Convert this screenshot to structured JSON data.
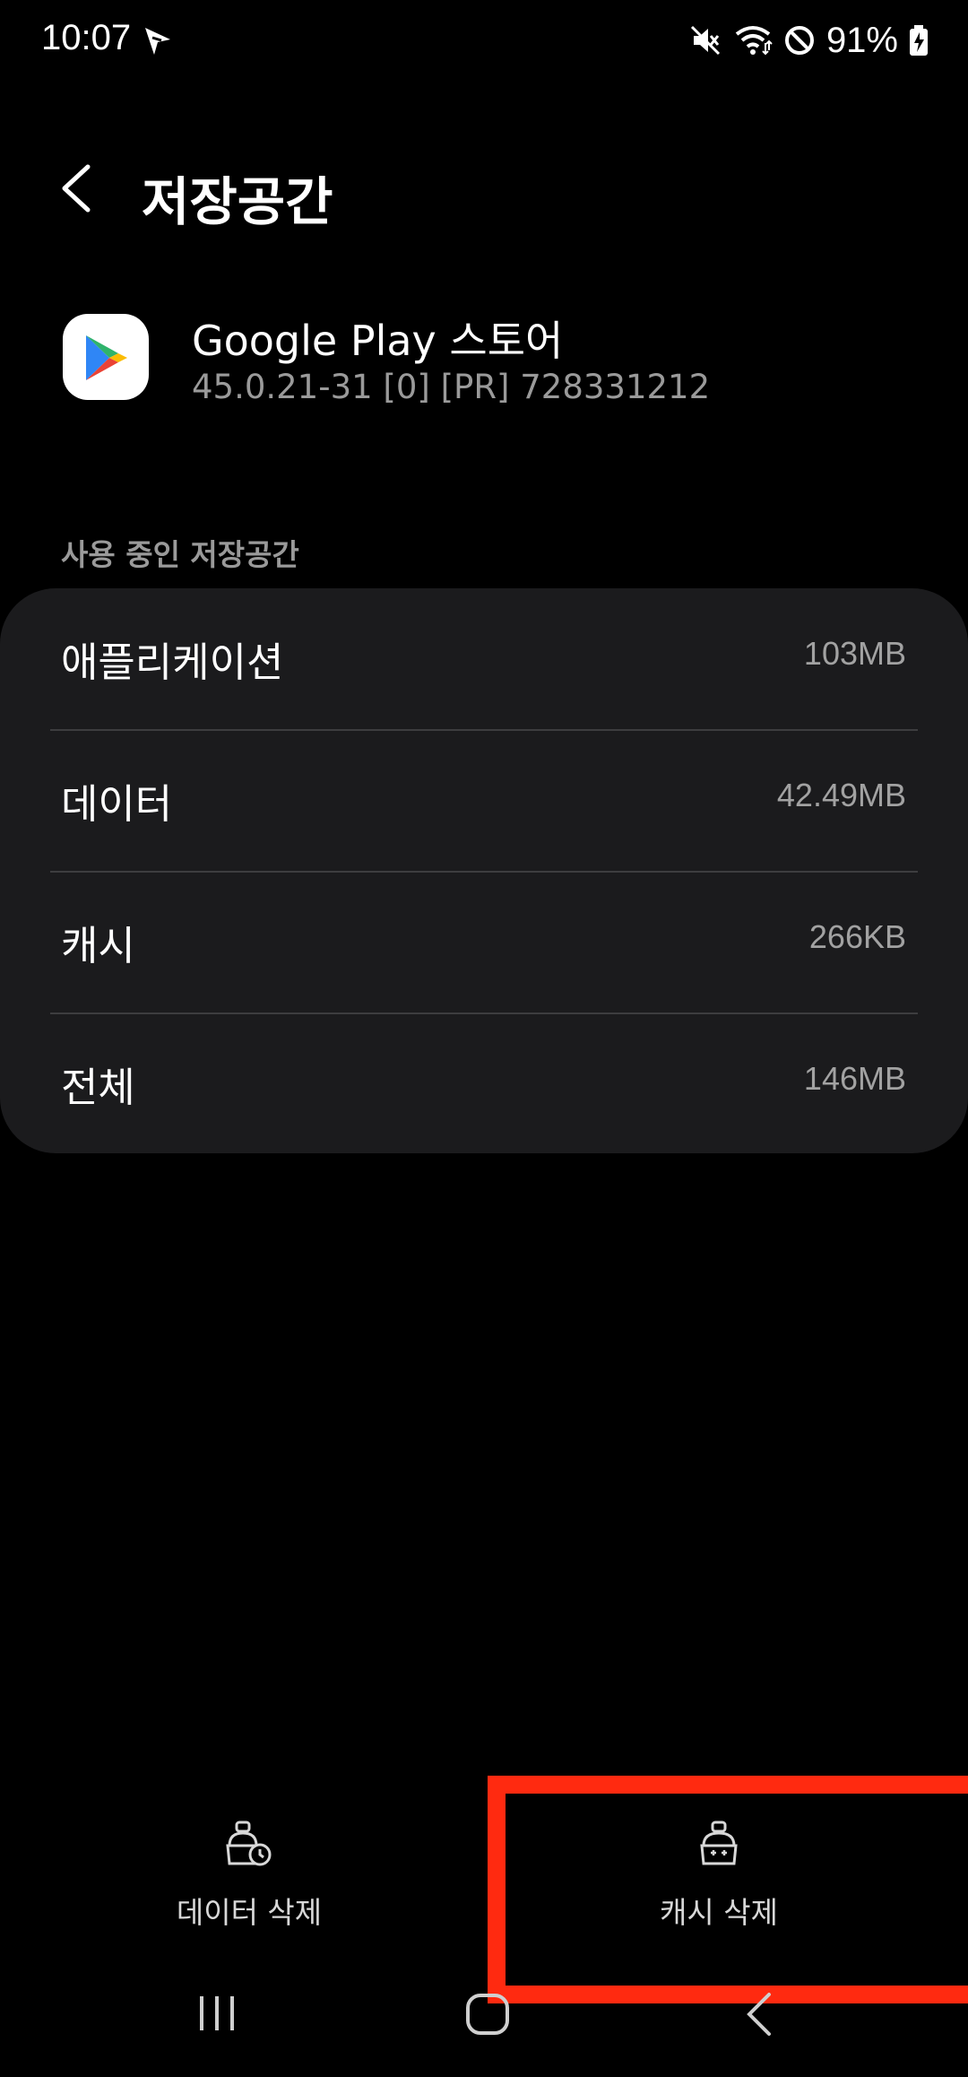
{
  "status_bar": {
    "time": "10:07",
    "battery": "91%",
    "icons": [
      "navigation-arrow-icon",
      "mute-icon",
      "wifi-icon",
      "do-not-disturb-icon",
      "battery-charging-icon"
    ]
  },
  "header": {
    "title": "저장공간",
    "back_icon": "back-chevron-icon"
  },
  "app": {
    "name": "Google Play 스토어",
    "version": "45.0.21-31 [0] [PR] 728331212",
    "icon": "google-play-icon"
  },
  "storage": {
    "section_label": "사용 중인 저장공간",
    "rows": [
      {
        "label": "애플리케이션",
        "value": "103MB"
      },
      {
        "label": "데이터",
        "value": "42.49MB"
      },
      {
        "label": "캐시",
        "value": "266KB"
      },
      {
        "label": "전체",
        "value": "146MB"
      }
    ]
  },
  "actions": {
    "clear_data": {
      "label": "데이터 삭제",
      "icon": "clear-data-brush-icon"
    },
    "clear_cache": {
      "label": "캐시 삭제",
      "icon": "clear-cache-brush-icon"
    }
  },
  "nav": {
    "recents_icon": "recent-apps-icon",
    "home_icon": "home-icon",
    "back_icon": "nav-back-icon"
  },
  "colors": {
    "background": "#000000",
    "card": "#1b1b1d",
    "secondary_text": "#9a9a9a",
    "highlight": "#ff2a10"
  }
}
